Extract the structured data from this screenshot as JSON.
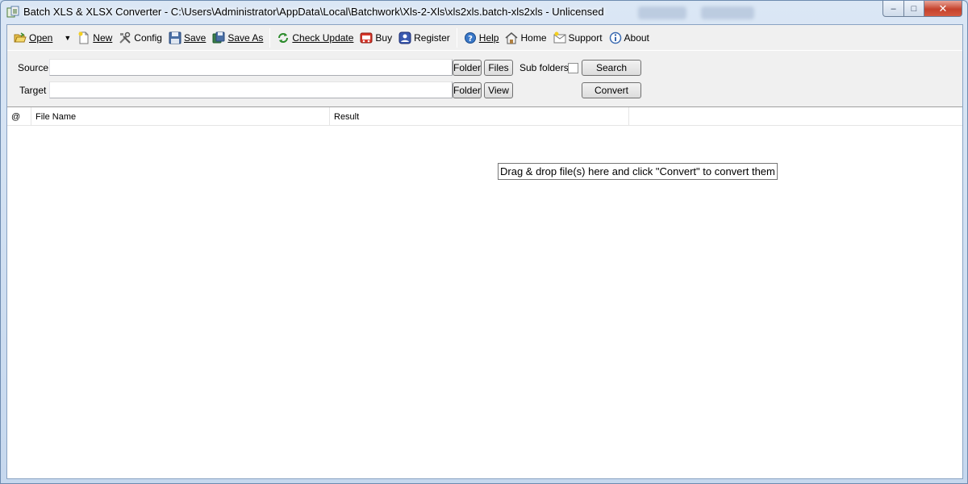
{
  "window": {
    "title": "Batch XLS & XLSX Converter - C:\\Users\\Administrator\\AppData\\Local\\Batchwork\\Xls-2-Xls\\xls2xls.batch-xls2xls - Unlicensed",
    "controls": {
      "minimize": "–",
      "maximize": "□",
      "close": "✕"
    }
  },
  "toolbar": {
    "items": [
      {
        "icon": "open-folder-icon",
        "label": "Open",
        "underline": "O"
      },
      {
        "icon": "new-file-icon",
        "label": "New",
        "underline": "N"
      },
      {
        "icon": "tools-icon",
        "label": "Config"
      },
      {
        "icon": "floppy-disk-icon",
        "label": "Save"
      },
      {
        "icon": "save-as-icon",
        "label": "Save As"
      },
      {
        "icon": "refresh-icon",
        "label": "Check Update"
      },
      {
        "icon": "cart-icon",
        "label": "Buy"
      },
      {
        "icon": "register-icon",
        "label": "Register"
      },
      {
        "icon": "help-icon",
        "label": "Help"
      },
      {
        "icon": "home-icon",
        "label": "Home"
      },
      {
        "icon": "support-icon",
        "label": "Support"
      },
      {
        "icon": "info-icon",
        "label": "About"
      }
    ]
  },
  "form": {
    "source_label": "Source",
    "source_value": "",
    "target_label": "Target",
    "target_value": "",
    "folder_button": "Folder",
    "files_button": "Files",
    "view_button": "View",
    "subfolders_label": "Sub folders",
    "subfolders_checked": false,
    "search_button": "Search",
    "convert_button": "Convert"
  },
  "list": {
    "columns": [
      "@",
      "File Name",
      "Result"
    ],
    "rows": [],
    "empty_hint": "Drag & drop file(s) here and click \"Convert\" to convert them"
  }
}
